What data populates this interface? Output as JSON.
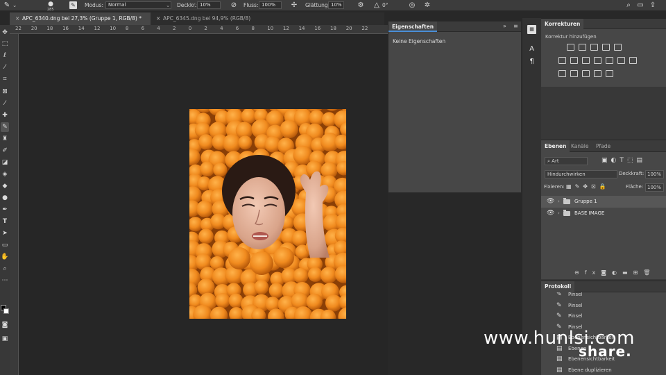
{
  "options_bar": {
    "brush_size": "285",
    "mode_label": "Modus:",
    "mode_value": "Normal",
    "opacity_label": "Deckkr.:",
    "opacity_value": "10%",
    "flow_label": "Fluss:",
    "flow_value": "100%",
    "smoothing_label": "Glättung:",
    "smoothing_value": "10%",
    "angle_value": "0°"
  },
  "tabs": [
    {
      "label": "APC_6340.dng bei 27,3% (Gruppe 1, RGB/8) *"
    },
    {
      "label": "APC_6345.dng bei 94,9% (RGB/8)"
    }
  ],
  "ruler": [
    "22",
    "20",
    "18",
    "16",
    "14",
    "12",
    "10",
    "8",
    "6",
    "4",
    "2",
    "0",
    "2",
    "4",
    "6",
    "8",
    "10",
    "12",
    "14",
    "16",
    "18",
    "20",
    "22"
  ],
  "properties": {
    "tab": "Eigenschaften",
    "empty_text": "Keine Eigenschaften"
  },
  "adjustments": {
    "tab": "Korrekturen",
    "subtitle": "Korrektur hinzufügen"
  },
  "layers_panel": {
    "tabs": [
      "Ebenen",
      "Kanäle",
      "Pfade"
    ],
    "filter_kind": "Art",
    "blend_mode": "Hindurchwirken",
    "opacity_label": "Deckkraft:",
    "opacity_value": "100%",
    "lock_label": "Fixieren:",
    "fill_label": "Fläche:",
    "fill_value": "100%",
    "layers": [
      {
        "name": "Gruppe 1"
      },
      {
        "name": "BASE IMAGE"
      }
    ]
  },
  "history": {
    "tab": "Protokoll",
    "items": [
      {
        "label": "Pinsel",
        "icon": "brush-icon"
      },
      {
        "label": "Pinsel",
        "icon": "brush-icon"
      },
      {
        "label": "Pinsel",
        "icon": "brush-icon"
      },
      {
        "label": "Pinsel",
        "icon": "brush-icon"
      },
      {
        "label": "Ebenensichtbarkeit",
        "icon": "layer-icon"
      },
      {
        "label": "Ebenen",
        "icon": "layer-icon"
      },
      {
        "label": "Ebenensichtbarkeit",
        "icon": "layer-icon"
      },
      {
        "label": "Ebene duplizieren",
        "icon": "layer-icon"
      }
    ]
  },
  "watermark": {
    "url": "www.hunlsi.com",
    "brand": "share."
  },
  "colors": {
    "accent": "#4a8fd8",
    "panel": "#474747",
    "canvas": "#262626"
  }
}
